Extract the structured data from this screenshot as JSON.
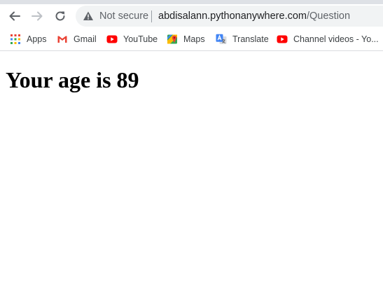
{
  "browser": {
    "security_label": "Not secure",
    "url_host": "abdisalann.pythonanywhere.com",
    "url_path": "/Question"
  },
  "bookmarks": [
    {
      "label": "Apps",
      "icon": "apps-grid-icon"
    },
    {
      "label": "Gmail",
      "icon": "gmail-icon"
    },
    {
      "label": "YouTube",
      "icon": "youtube-icon"
    },
    {
      "label": "Maps",
      "icon": "maps-icon"
    },
    {
      "label": "Translate",
      "icon": "translate-icon"
    },
    {
      "label": "Channel videos - Yo...",
      "icon": "youtube-icon"
    }
  ],
  "page": {
    "heading": "Your age is 89"
  },
  "colors": {
    "accent_red": "#ff0000",
    "text_dark": "#202124",
    "text_muted": "#5f6368"
  }
}
